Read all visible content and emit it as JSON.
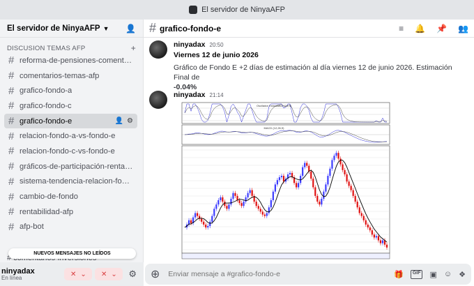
{
  "window": {
    "title": "El servidor de NinyaAFP"
  },
  "guild": {
    "name": "El servidor de NinyaAFP"
  },
  "category": {
    "label": "DISCUSION TEMAS AFP"
  },
  "channels": [
    {
      "label": "reforma-de-pensiones-comentari..."
    },
    {
      "label": "comentarios-temas-afp"
    },
    {
      "label": "grafico-fondo-a"
    },
    {
      "label": "grafico-fondo-c"
    },
    {
      "label": "grafico-fondo-e"
    },
    {
      "label": "relacion-fondo-a-vs-fondo-e"
    },
    {
      "label": "relacion-fondo-c-vs-fondo-e"
    },
    {
      "label": "gráficos-de-participación-rentabi..."
    },
    {
      "label": "sistema-tendencia-relacion-fond..."
    },
    {
      "label": "cambio-de-fondo"
    },
    {
      "label": "rentabilidad-afp"
    },
    {
      "label": "afp-bot"
    }
  ],
  "hidden_channel": {
    "label": "comentarios-inversiones"
  },
  "new_messages_banner": "NUEVOS MENSAJES NO LEÍDOS",
  "user": {
    "name": "ninyadax",
    "status": "En línea"
  },
  "header": {
    "channel": "grafico-fondo-e"
  },
  "messages": [
    {
      "author": "ninyadax",
      "time": "20:50",
      "title": "Viernes 12 de junio 2026",
      "text": "Gráfico de Fondo E +2 días de estimación al día viernes 12 de junio 2026. Estimación Final de",
      "estimate": "-0.04%"
    },
    {
      "author": "ninyadax",
      "time": "21:14"
    }
  ],
  "composer": {
    "placeholder": "Enviar mensaje a #grafico-fondo-e"
  },
  "attachment": {
    "panel1_label": "Oscilador Estocástico (14,3)",
    "panel2_label": "MACD (12,26,9)",
    "price_series": [
      42,
      44,
      47,
      45,
      49,
      52,
      50,
      48,
      46,
      44,
      42,
      43,
      46,
      50,
      55,
      58,
      61,
      63,
      60,
      57,
      55,
      58,
      62,
      66,
      64,
      61,
      59,
      57,
      60,
      63,
      66,
      68,
      64,
      60,
      57,
      55,
      53,
      51,
      50,
      52,
      56,
      61,
      67,
      72,
      75,
      77,
      78,
      74,
      76,
      79,
      80,
      77,
      73,
      70,
      73,
      78,
      84,
      87,
      85,
      81,
      76,
      70,
      64,
      60,
      58,
      62,
      67,
      72,
      78,
      83,
      89,
      92,
      94,
      90,
      86,
      82,
      79,
      74,
      71,
      68,
      64,
      60,
      56,
      52,
      50,
      47,
      44,
      42,
      40,
      37,
      35,
      36,
      33,
      31,
      33,
      30,
      28
    ]
  }
}
